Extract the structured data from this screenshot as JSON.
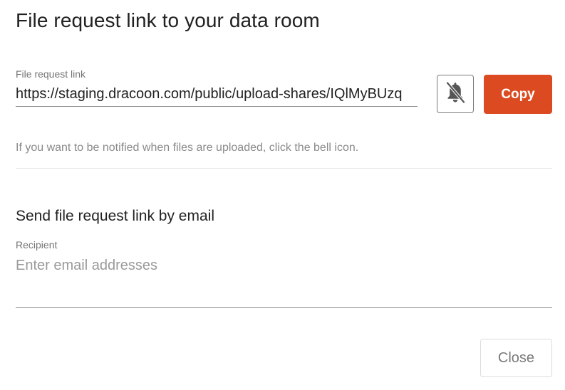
{
  "dialog": {
    "title": "File request link to your data room"
  },
  "link_field": {
    "label": "File request link",
    "value": "https://staging.dracoon.com/public/upload-shares/IQlMyBUzq"
  },
  "notify_button": {
    "icon": "bell-off-icon"
  },
  "copy_button": {
    "label": "Copy",
    "color": "#db4a20"
  },
  "hint": "If you want to be notified when files are uploaded, click the bell icon.",
  "email_section": {
    "title": "Send file request link by email",
    "recipient_label": "Recipient",
    "recipient_placeholder": "Enter email addresses",
    "recipient_value": ""
  },
  "close_button": {
    "label": "Close"
  }
}
